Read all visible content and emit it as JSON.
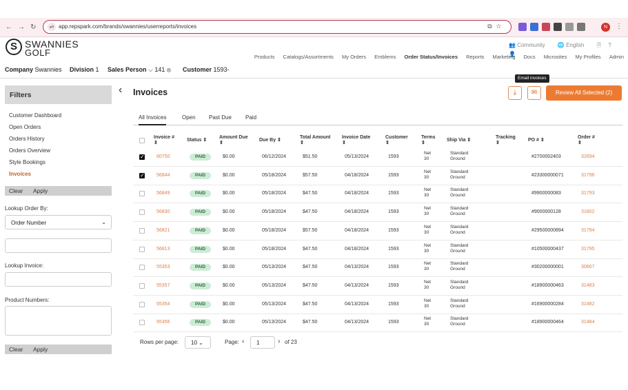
{
  "browser": {
    "url": "app.repspark.com/brands/swannies/userreports/invoices",
    "profile_initial": "N"
  },
  "site": {
    "logo_line1": "SWANNIES",
    "logo_line2": "GOLF",
    "logo_mark": "S",
    "util_links": [
      "Community",
      "English"
    ],
    "nav": [
      "Products",
      "Catalogs/Assortments",
      "My Orders",
      "Emblems",
      "Order Status/Invoices",
      "Reports",
      "Marketing",
      "Docs",
      "Microsites",
      "My Profiles",
      "Admin"
    ]
  },
  "context": {
    "company_label": "Company",
    "company_value": "Swannies",
    "division_label": "Division",
    "division_value": "1",
    "sales_person_label": "Sales Person",
    "sales_person_value": "141",
    "customer_label": "Customer",
    "customer_value": "1593-"
  },
  "sidebar": {
    "title": "Filters",
    "links": [
      "Customer Dashboard",
      "Open Orders",
      "Orders History",
      "Orders Overview",
      "Style Bookings",
      "Invoices"
    ],
    "clear_label": "Clear",
    "apply_label": "Apply",
    "lookup_order_label": "Lookup Order By:",
    "lookup_order_value": "Order Number",
    "lookup_invoice_label": "Lookup Invoice:",
    "product_numbers_label": "Product Numbers:"
  },
  "main": {
    "title": "Invoices",
    "tooltip": "Email invoices",
    "review_button": "Review All Selected (2)",
    "tabs": [
      "All Invoices",
      "Open",
      "Past Due",
      "Paid"
    ],
    "columns": [
      [
        "Invoice #",
        "⇕"
      ],
      [
        "Status ⇕",
        ""
      ],
      [
        "Amount Due",
        "⇕"
      ],
      [
        "Due By ⇕",
        ""
      ],
      [
        "Total Amount",
        "⇕"
      ],
      [
        "Invoice Date",
        "⇕"
      ],
      [
        "Customer",
        "⇕"
      ],
      [
        "Terms",
        "⇕"
      ],
      [
        "Ship Via ⇕",
        ""
      ],
      [
        "Tracking",
        "⇕"
      ],
      [
        "PO # ⇕",
        ""
      ],
      [
        "Order #",
        "⇕"
      ]
    ],
    "rows": [
      {
        "checked": true,
        "invoice": "60750",
        "status": "PAID",
        "due": "$0.00",
        "due_by": "06/12/2024",
        "total": "$51.50",
        "date": "05/13/2024",
        "customer": "1593",
        "terms1": "Net",
        "terms2": "30",
        "ship1": "Standard",
        "ship2": "Ground",
        "tracking": "",
        "po": "#2700002403",
        "order": "32694"
      },
      {
        "checked": true,
        "invoice": "56844",
        "status": "PAID",
        "due": "$0.00",
        "due_by": "05/18/2024",
        "total": "$57.50",
        "date": "04/18/2024",
        "customer": "1593",
        "terms1": "Net",
        "terms2": "30",
        "ship1": "Standard",
        "ship2": "Ground",
        "tracking": "",
        "po": "#23300000071",
        "order": "31796"
      },
      {
        "checked": false,
        "invoice": "56849",
        "status": "PAID",
        "due": "$0.00",
        "due_by": "05/18/2024",
        "total": "$47.50",
        "date": "04/18/2024",
        "customer": "1593",
        "terms1": "Net",
        "terms2": "30",
        "ship1": "Standard",
        "ship2": "Ground",
        "tracking": "",
        "po": "#9900000083",
        "order": "31793"
      },
      {
        "checked": false,
        "invoice": "56830",
        "status": "PAID",
        "due": "$0.00",
        "due_by": "05/18/2024",
        "total": "$47.50",
        "date": "04/18/2024",
        "customer": "1593",
        "terms1": "Net",
        "terms2": "30",
        "ship1": "Standard",
        "ship2": "Ground",
        "tracking": "",
        "po": "#9000000128",
        "order": "31802"
      },
      {
        "checked": false,
        "invoice": "56821",
        "status": "PAID",
        "due": "$0.00",
        "due_by": "05/18/2024",
        "total": "$57.50",
        "date": "04/18/2024",
        "customer": "1593",
        "terms1": "Net",
        "terms2": "30",
        "ship1": "Standard",
        "ship2": "Ground",
        "tracking": "",
        "po": "#29500000894",
        "order": "31794"
      },
      {
        "checked": false,
        "invoice": "56813",
        "status": "PAID",
        "due": "$0.00",
        "due_by": "05/18/2024",
        "total": "$47.50",
        "date": "04/18/2024",
        "customer": "1593",
        "terms1": "Net",
        "terms2": "30",
        "ship1": "Standard",
        "ship2": "Ground",
        "tracking": "",
        "po": "#10500000437",
        "order": "31795"
      },
      {
        "checked": false,
        "invoice": "55353",
        "status": "PAID",
        "due": "$0.00",
        "due_by": "05/13/2024",
        "total": "$47.50",
        "date": "04/13/2024",
        "customer": "1593",
        "terms1": "Net",
        "terms2": "30",
        "ship1": "Standard",
        "ship2": "Ground",
        "tracking": "",
        "po": "#30200000001",
        "order": "30667"
      },
      {
        "checked": false,
        "invoice": "55357",
        "status": "PAID",
        "due": "$0.00",
        "due_by": "05/13/2024",
        "total": "$47.50",
        "date": "04/13/2024",
        "customer": "1593",
        "terms1": "Net",
        "terms2": "30",
        "ship1": "Standard",
        "ship2": "Ground",
        "tracking": "",
        "po": "#18900000463",
        "order": "31483"
      },
      {
        "checked": false,
        "invoice": "55354",
        "status": "PAID",
        "due": "$0.00",
        "due_by": "05/13/2024",
        "total": "$47.50",
        "date": "04/13/2024",
        "customer": "1593",
        "terms1": "Net",
        "terms2": "30",
        "ship1": "Standard",
        "ship2": "Ground",
        "tracking": "",
        "po": "#16900000284",
        "order": "31482"
      },
      {
        "checked": false,
        "invoice": "55356",
        "status": "PAID",
        "due": "$0.00",
        "due_by": "05/13/2024",
        "total": "$47.50",
        "date": "04/13/2024",
        "customer": "1593",
        "terms1": "Net",
        "terms2": "30",
        "ship1": "Standard",
        "ship2": "Ground",
        "tracking": "",
        "po": "#18900000464",
        "order": "31484"
      }
    ],
    "rows_per_page_label": "Rows per page:",
    "rows_per_page_value": "10",
    "page_label": "Page:",
    "page_value": "1",
    "page_total": "of 23"
  },
  "colors": {
    "accent": "#ec7b32",
    "link": "#d9804a",
    "paid_badge_bg": "#cdebd5",
    "paid_badge_text": "#2a6e3f",
    "url_border": "#b03a4e"
  },
  "icons": [
    "back-icon",
    "forward-icon",
    "reload-icon",
    "site-info-icon",
    "bookmark-star-icon",
    "download-icon",
    "email-icon",
    "chevron-down-icon",
    "clear-x-icon",
    "chevron-left-icon",
    "chevron-right-icon",
    "sort-icon"
  ]
}
